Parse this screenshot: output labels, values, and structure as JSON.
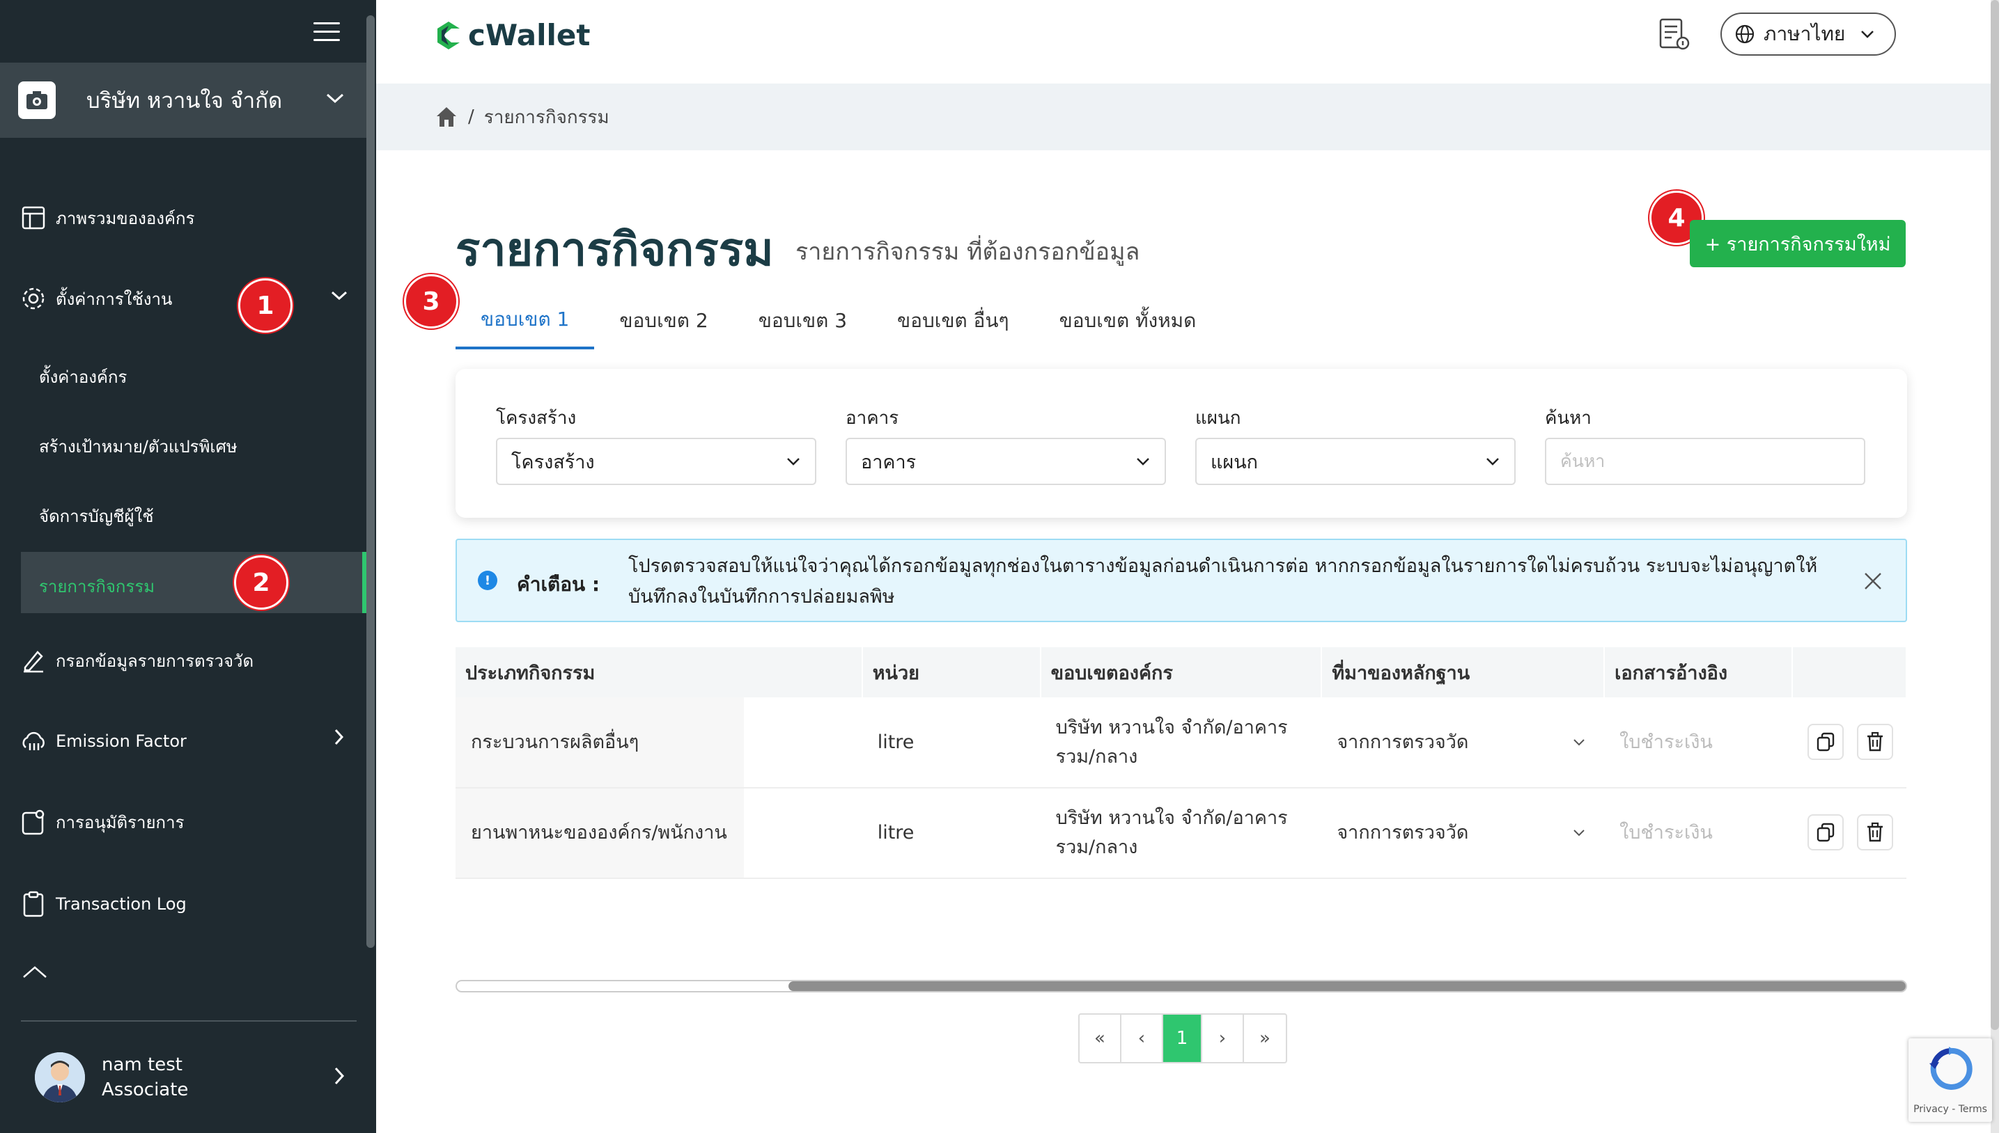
{
  "sidebar": {
    "company_name": "บริษัท หวานใจ จำกัด",
    "items": [
      {
        "label": "ภาพรวมขององค์กร",
        "icon": "layout-icon"
      },
      {
        "label": "ตั้งค่าการใช้งาน",
        "icon": "gear-icon"
      },
      {
        "label": "ตั้งค่าองค์กร"
      },
      {
        "label": "สร้างเป้าหมาย/ตัวแปรพิเศษ"
      },
      {
        "label": "จัดการบัญชีผู้ใช้"
      },
      {
        "label": "รายการกิจกรรม"
      },
      {
        "label": "กรอกข้อมูลรายการตรวจวัด",
        "icon": "pencil-icon"
      },
      {
        "label": "Emission Factor",
        "icon": "cloud-icon"
      },
      {
        "label": "การอนุมัติรายการ",
        "icon": "approval-icon"
      },
      {
        "label": "Transaction Log",
        "icon": "clipboard-icon"
      }
    ],
    "user": {
      "name": "nam test",
      "role": "Associate"
    }
  },
  "badges": [
    "1",
    "2",
    "3",
    "4"
  ],
  "header": {
    "logo": "cWallet",
    "language": "ภาษาไทย"
  },
  "breadcrumb": {
    "current": "รายการกิจกรรม"
  },
  "page": {
    "title": "รายการกิจกรรม",
    "subtitle": "รายการกิจกรรม ที่ต้องกรอกข้อมูล",
    "new_button": "+ รายการกิจกรรมใหม่"
  },
  "tabs": [
    "ขอบเขต 1",
    "ขอบเขต 2",
    "ขอบเขต 3",
    "ขอบเขต อื่นๆ",
    "ขอบเขต ทั้งหมด"
  ],
  "filters": {
    "structure_label": "โครงสร้าง",
    "structure_value": "โครงสร้าง",
    "building_label": "อาคาร",
    "building_value": "อาคาร",
    "department_label": "แผนก",
    "department_value": "แผนก",
    "search_label": "ค้นหา",
    "search_placeholder": "ค้นหา"
  },
  "alert": {
    "title": "คำเตือน :",
    "body": "โปรดตรวจสอบให้แน่ใจว่าคุณได้กรอกข้อมูลทุกช่องในตารางข้อมูลก่อนดำเนินการต่อ หากกรอกข้อมูลในรายการใดไม่ครบถ้วน ระบบจะไม่อนุญาตให้บันทึกลงในบันทึกการปล่อยมลพิษ"
  },
  "table": {
    "headers": [
      "ประเภทกิจกรรม",
      "หน่วย",
      "ขอบเขตองค์กร",
      "ที่มาของหลักฐาน",
      "เอกสารอ้างอิง"
    ],
    "rows": [
      {
        "type": "กระบวนการผลิตอื่นๆ",
        "unit": "litre",
        "scope": "บริษัท หวานใจ จำกัด/อาคารรวม/กลาง",
        "source": "จากการตรวจวัด",
        "doc": "ใบชำระเงิน"
      },
      {
        "type": "ยานพาหนะขององค์กร/พนักงาน",
        "unit": "litre",
        "scope": "บริษัท หวานใจ จำกัด/อาคารรวม/กลาง",
        "source": "จากการตรวจวัด",
        "doc": "ใบชำระเงิน"
      }
    ]
  },
  "pagination": {
    "first": "«",
    "prev": "‹",
    "current": "1",
    "next": "›",
    "last": "»"
  },
  "recaptcha": {
    "text": "Privacy - Terms"
  },
  "colors": {
    "sidebar": "#1f2a30",
    "accent_green": "#2fc66f",
    "button_green": "#23b14d",
    "tab_blue": "#1e73c8",
    "badge_red": "#e31e24"
  }
}
